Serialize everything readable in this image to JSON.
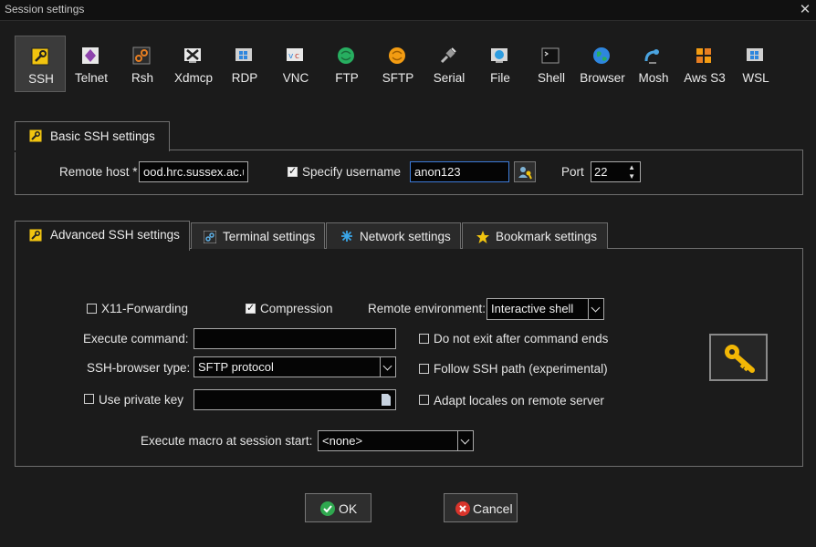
{
  "window": {
    "title": "Session settings"
  },
  "protocols": [
    {
      "label": "SSH",
      "icon": "wrench-icon",
      "active": true
    },
    {
      "label": "Telnet",
      "icon": "telnet-icon"
    },
    {
      "label": "Rsh",
      "icon": "rsh-icon"
    },
    {
      "label": "Xdmcp",
      "icon": "xdmcp-icon"
    },
    {
      "label": "RDP",
      "icon": "rdp-icon"
    },
    {
      "label": "VNC",
      "icon": "vnc-icon"
    },
    {
      "label": "FTP",
      "icon": "ftp-icon"
    },
    {
      "label": "SFTP",
      "icon": "sftp-icon"
    },
    {
      "label": "Serial",
      "icon": "serial-icon"
    },
    {
      "label": "File",
      "icon": "file-icon"
    },
    {
      "label": "Shell",
      "icon": "shell-icon"
    },
    {
      "label": "Browser",
      "icon": "browser-icon"
    },
    {
      "label": "Mosh",
      "icon": "mosh-icon"
    },
    {
      "label": "Aws S3",
      "icon": "aws-s3-icon"
    },
    {
      "label": "WSL",
      "icon": "wsl-icon"
    }
  ],
  "basic": {
    "tab_label": "Basic SSH settings",
    "remote_host_label": "Remote host *",
    "remote_host_value": "ood.hrc.sussex.ac.u",
    "specify_username_label": "Specify username",
    "specify_username_checked": true,
    "username_value": "anon123",
    "port_label": "Port",
    "port_value": "22"
  },
  "tabs": [
    {
      "label": "Advanced SSH settings",
      "icon": "wrench-icon",
      "active": true
    },
    {
      "label": "Terminal settings",
      "icon": "terminal-icon"
    },
    {
      "label": "Network settings",
      "icon": "network-icon"
    },
    {
      "label": "Bookmark settings",
      "icon": "star-icon"
    }
  ],
  "advanced": {
    "x11_label": "X11-Forwarding",
    "x11_checked": false,
    "compression_label": "Compression",
    "compression_checked": true,
    "remote_env_label": "Remote environment:",
    "remote_env_value": "Interactive shell",
    "execute_command_label": "Execute command:",
    "execute_command_value": "",
    "do_not_exit_label": "Do not exit after command ends",
    "ssh_browser_label": "SSH-browser type:",
    "ssh_browser_value": "SFTP protocol",
    "follow_ssh_path_label": "Follow SSH path (experimental)",
    "use_private_key_label": "Use private key",
    "adapt_locales_label": "Adapt locales on remote server",
    "macro_label": "Execute macro at session start:",
    "macro_value": "<none>"
  },
  "buttons": {
    "ok": "OK",
    "cancel": "Cancel"
  },
  "colors": {
    "accent": "#3d7bd8",
    "ok_green": "#2fa84f",
    "cancel_red": "#d9342b",
    "key_gold": "#f2b705"
  }
}
